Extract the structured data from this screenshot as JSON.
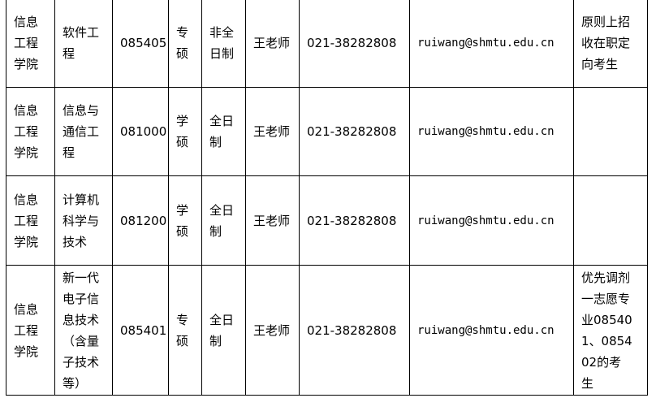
{
  "rows": [
    {
      "college": "信息工程学院",
      "major": "软件工程",
      "code": "085405",
      "degree": "专硕",
      "mode": "非全日制",
      "contact": "王老师",
      "phone": "021-38282808",
      "email": "ruiwang@shmtu.edu.cn",
      "note": "原则上招收在职定向考生"
    },
    {
      "college": "信息工程学院",
      "major": "信息与通信工程",
      "code": "081000",
      "degree": "学硕",
      "mode": "全日制",
      "contact": "王老师",
      "phone": "021-38282808",
      "email": "ruiwang@shmtu.edu.cn",
      "note": ""
    },
    {
      "college": "信息工程学院",
      "major": "计算机科学与技术",
      "code": "081200",
      "degree": "学硕",
      "mode": "全日制",
      "contact": "王老师",
      "phone": "021-38282808",
      "email": "ruiwang@shmtu.edu.cn",
      "note": ""
    },
    {
      "college": "信息工程学院",
      "major": "新一代电子信息技术（含量子技术等）",
      "code": "085401",
      "degree": "专硕",
      "mode": "全日制",
      "contact": "王老师",
      "phone": "021-38282808",
      "email": "ruiwang@shmtu.edu.cn",
      "note": "优先调剂一志愿专业085401、085402的考生"
    }
  ]
}
